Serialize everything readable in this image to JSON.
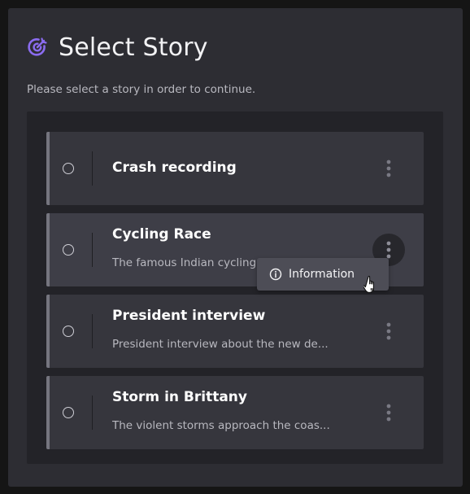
{
  "dialog": {
    "title": "Select Story",
    "subtitle": "Please select a story in order to continue."
  },
  "stories": [
    {
      "title": "Crash recording",
      "description": ""
    },
    {
      "title": "Cycling Race",
      "description": "The famous Indian cycling race MTb..."
    },
    {
      "title": "President interview",
      "description": "President interview about the new de..."
    },
    {
      "title": "Storm in Brittany",
      "description": "The violent storms approach the coas..."
    }
  ],
  "context_menu": {
    "items": [
      {
        "label": "Information",
        "icon": "info-icon"
      }
    ]
  },
  "colors": {
    "accent": "#8b6cf0",
    "dialog_bg": "#2d2d33",
    "card_bg": "#36363d",
    "card_border": "#75757f"
  }
}
